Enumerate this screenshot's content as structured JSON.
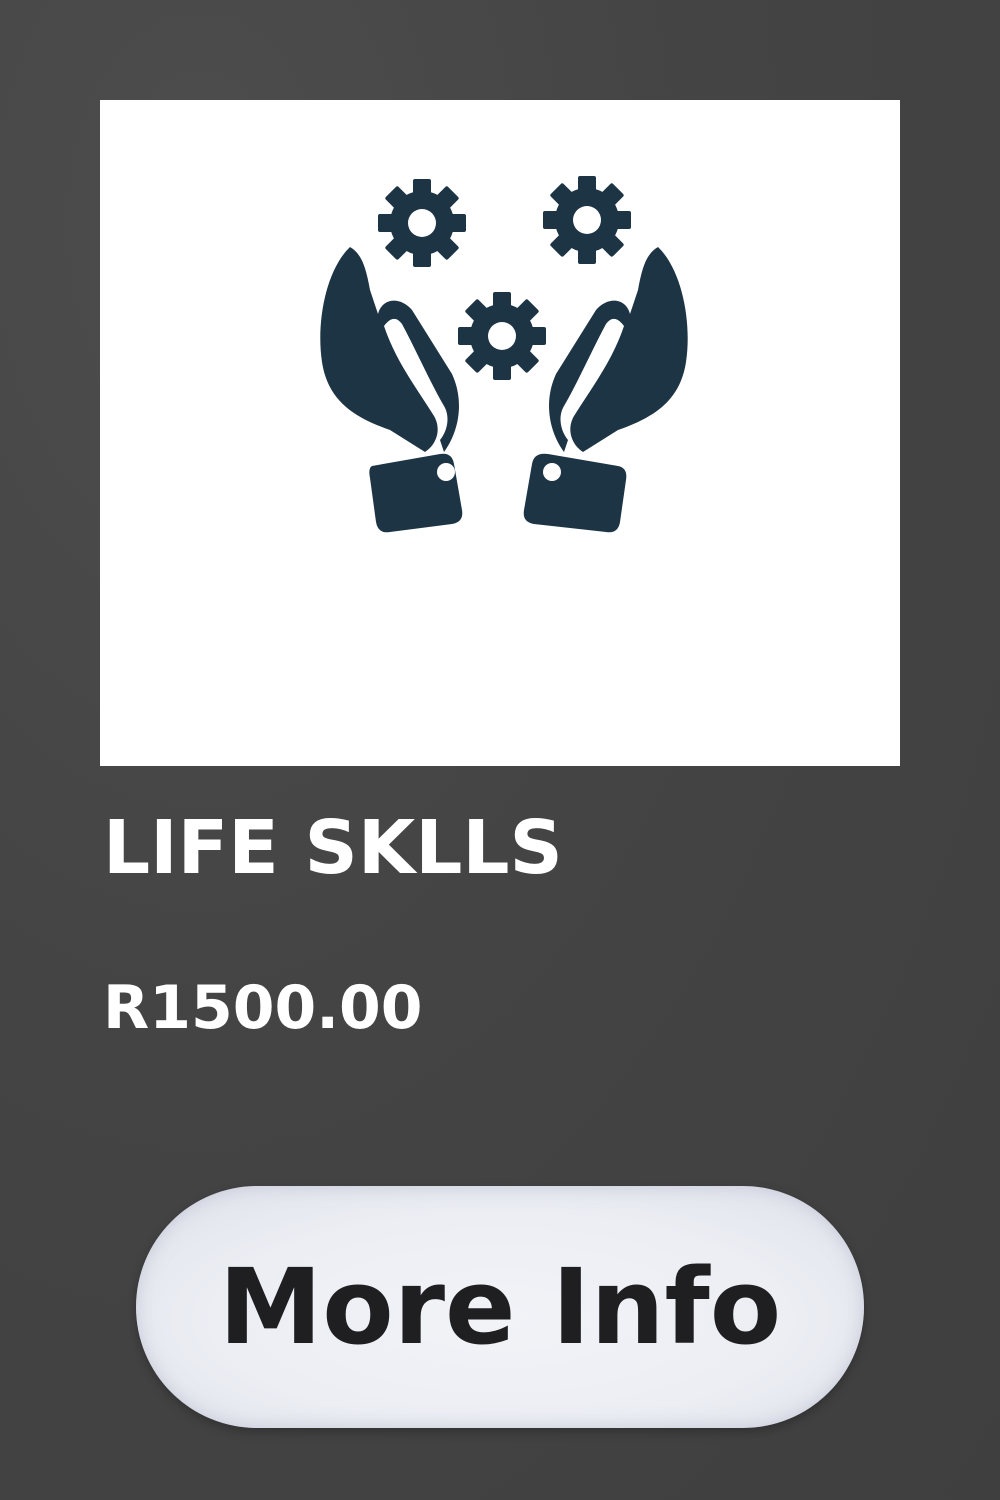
{
  "product": {
    "title": "LIFE SKLLS",
    "price": "R1500.00",
    "image_icon": "hands-holding-gears-icon",
    "icon_color": "#1d3445"
  },
  "actions": {
    "more_info_label": "More Info"
  }
}
